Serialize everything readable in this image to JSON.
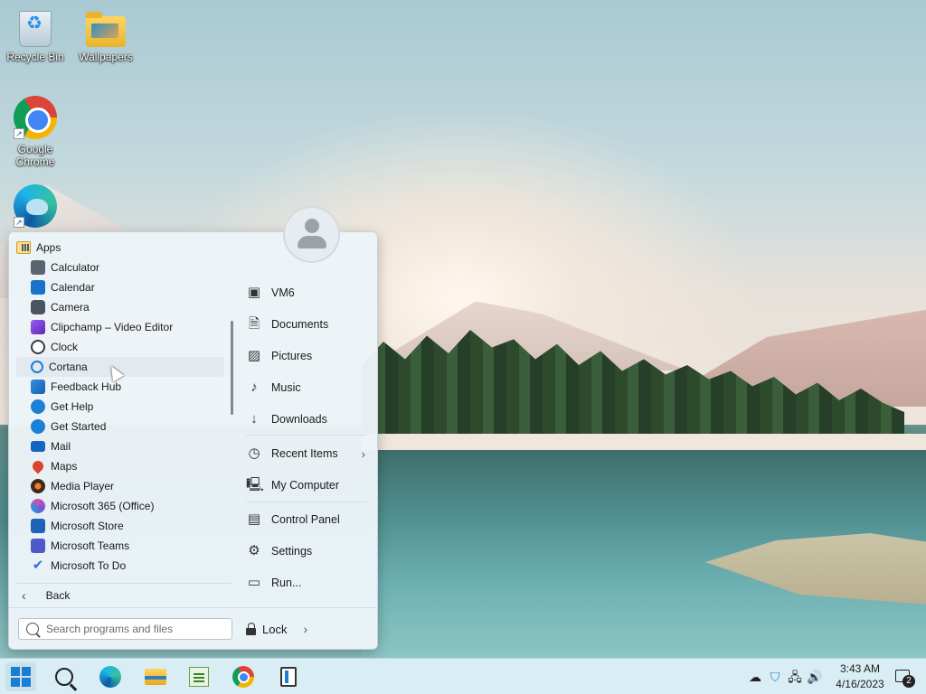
{
  "desktop": {
    "icons": [
      {
        "label": "Recycle Bin",
        "icon": "recycle-bin-icon"
      },
      {
        "label": "Wallpapers",
        "icon": "folder-icon"
      },
      {
        "label": "Google Chrome",
        "icon": "chrome-icon"
      },
      {
        "label": "",
        "icon": "edge-icon"
      }
    ]
  },
  "start_menu": {
    "apps_header": "Apps",
    "apps": [
      {
        "label": "Calculator",
        "icon": "calculator-icon",
        "color": "#5a6470"
      },
      {
        "label": "Calendar",
        "icon": "calendar-icon",
        "color": "#1a73c8"
      },
      {
        "label": "Camera",
        "icon": "camera-icon",
        "color": "#4a5560"
      },
      {
        "label": "Clipchamp – Video Editor",
        "icon": "clipchamp-icon",
        "color": "#7b3fd1"
      },
      {
        "label": "Clock",
        "icon": "clock-icon",
        "color": "#3a3a3a"
      },
      {
        "label": "Cortana",
        "icon": "cortana-icon",
        "color": "#1a80d8"
      },
      {
        "label": "Feedback Hub",
        "icon": "feedback-hub-icon",
        "color": "#1a73c8"
      },
      {
        "label": "Get Help",
        "icon": "get-help-icon",
        "color": "#1a80d8"
      },
      {
        "label": "Get Started",
        "icon": "get-started-icon",
        "color": "#1a80d8"
      },
      {
        "label": "Mail",
        "icon": "mail-icon",
        "color": "#1566c0"
      },
      {
        "label": "Maps",
        "icon": "maps-icon",
        "color": "#d8442f"
      },
      {
        "label": "Media Player",
        "icon": "media-player-icon",
        "color": "#ff7a1a"
      },
      {
        "label": "Microsoft 365 (Office)",
        "icon": "office-icon",
        "color": "#7a54d0"
      },
      {
        "label": "Microsoft Store",
        "icon": "store-icon",
        "color": "#1e63b8"
      },
      {
        "label": "Microsoft Teams",
        "icon": "teams-icon",
        "color": "#5059c9"
      },
      {
        "label": "Microsoft To Do",
        "icon": "todo-icon",
        "color": "#2f72de"
      }
    ],
    "hovered_app": "Cortana",
    "back_label": "Back",
    "search_placeholder": "Search programs and files",
    "lock_label": "Lock",
    "places": [
      {
        "label": "VM6",
        "icon": "user-folder-icon"
      },
      {
        "label": "Documents",
        "icon": "documents-icon"
      },
      {
        "label": "Pictures",
        "icon": "pictures-icon"
      },
      {
        "label": "Music",
        "icon": "music-icon"
      },
      {
        "label": "Downloads",
        "icon": "downloads-icon"
      }
    ],
    "recent": {
      "label": "Recent Items",
      "icon": "recent-items-icon"
    },
    "computer": {
      "label": "My Computer",
      "icon": "my-computer-icon"
    },
    "system": [
      {
        "label": "Control Panel",
        "icon": "control-panel-icon"
      },
      {
        "label": "Settings",
        "icon": "settings-icon"
      },
      {
        "label": "Run...",
        "icon": "run-icon"
      }
    ]
  },
  "taskbar": {
    "apps": [
      "start-icon",
      "search-icon",
      "edge-icon",
      "file-explorer-icon",
      "notepad-icon",
      "chrome-icon",
      "app-icon"
    ],
    "tray_icons": [
      "onedrive-icon",
      "security-icon",
      "network-icon",
      "volume-icon"
    ],
    "time": "3:43 AM",
    "date": "4/16/2023",
    "notification_count": "2"
  }
}
